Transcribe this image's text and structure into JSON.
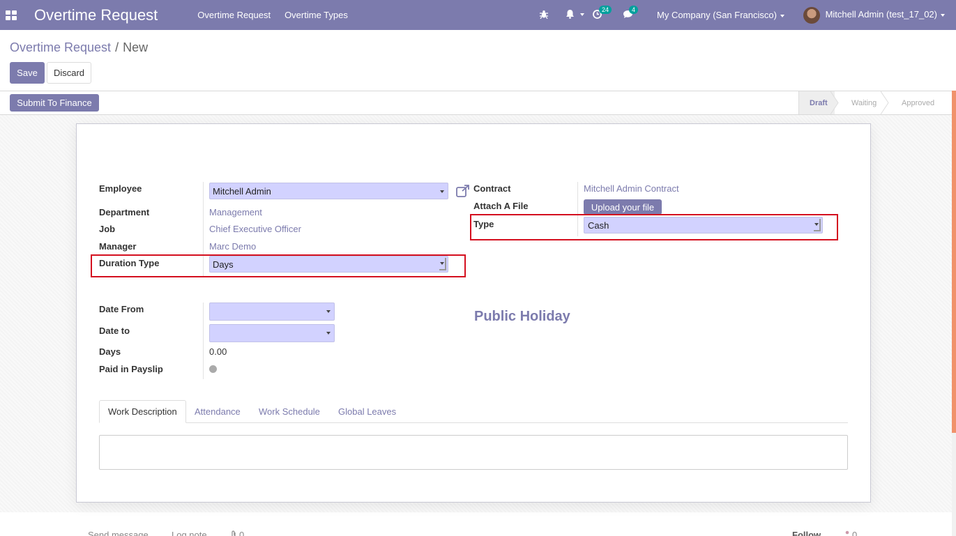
{
  "navbar": {
    "app_title": "Overtime Request",
    "menu": [
      "Overtime Request",
      "Overtime Types"
    ],
    "activity_count": "24",
    "message_count": "4",
    "company": "My Company (San Francisco)",
    "user": "Mitchell Admin (test_17_02)"
  },
  "breadcrumb": {
    "parent": "Overtime Request",
    "separator": "/",
    "current": "New"
  },
  "buttons": {
    "save": "Save",
    "discard": "Discard",
    "submit": "Submit To Finance"
  },
  "stages": [
    "Draft",
    "Waiting",
    "Approved"
  ],
  "stage_active": "Draft",
  "form": {
    "employee": {
      "label": "Employee",
      "value": "Mitchell Admin"
    },
    "department": {
      "label": "Department",
      "value": "Management"
    },
    "job": {
      "label": "Job",
      "value": "Chief Executive Officer"
    },
    "manager": {
      "label": "Manager",
      "value": "Marc Demo"
    },
    "duration_type": {
      "label": "Duration Type",
      "value": "Days"
    },
    "contract": {
      "label": "Contract",
      "value": "Mitchell Admin Contract"
    },
    "attach": {
      "label": "Attach A File",
      "button": "Upload your file"
    },
    "type": {
      "label": "Type",
      "value": "Cash"
    },
    "date_from": {
      "label": "Date From",
      "value": ""
    },
    "date_to": {
      "label": "Date to",
      "value": ""
    },
    "days": {
      "label": "Days",
      "value": "0.00"
    },
    "paid_in_payslip": {
      "label": "Paid in Payslip"
    },
    "public_holiday": "Public Holiday"
  },
  "tabs": [
    "Work Description",
    "Attendance",
    "Work Schedule",
    "Global Leaves"
  ],
  "chatter": {
    "send_message": "Send message",
    "log_note": "Log note",
    "attachments": "0",
    "follow": "Follow",
    "followers": "0"
  },
  "colors": {
    "brand": "#7c7bad",
    "field_bg": "#d2d2ff",
    "highlight": "#d40f1f",
    "accent": "#f0926b"
  }
}
